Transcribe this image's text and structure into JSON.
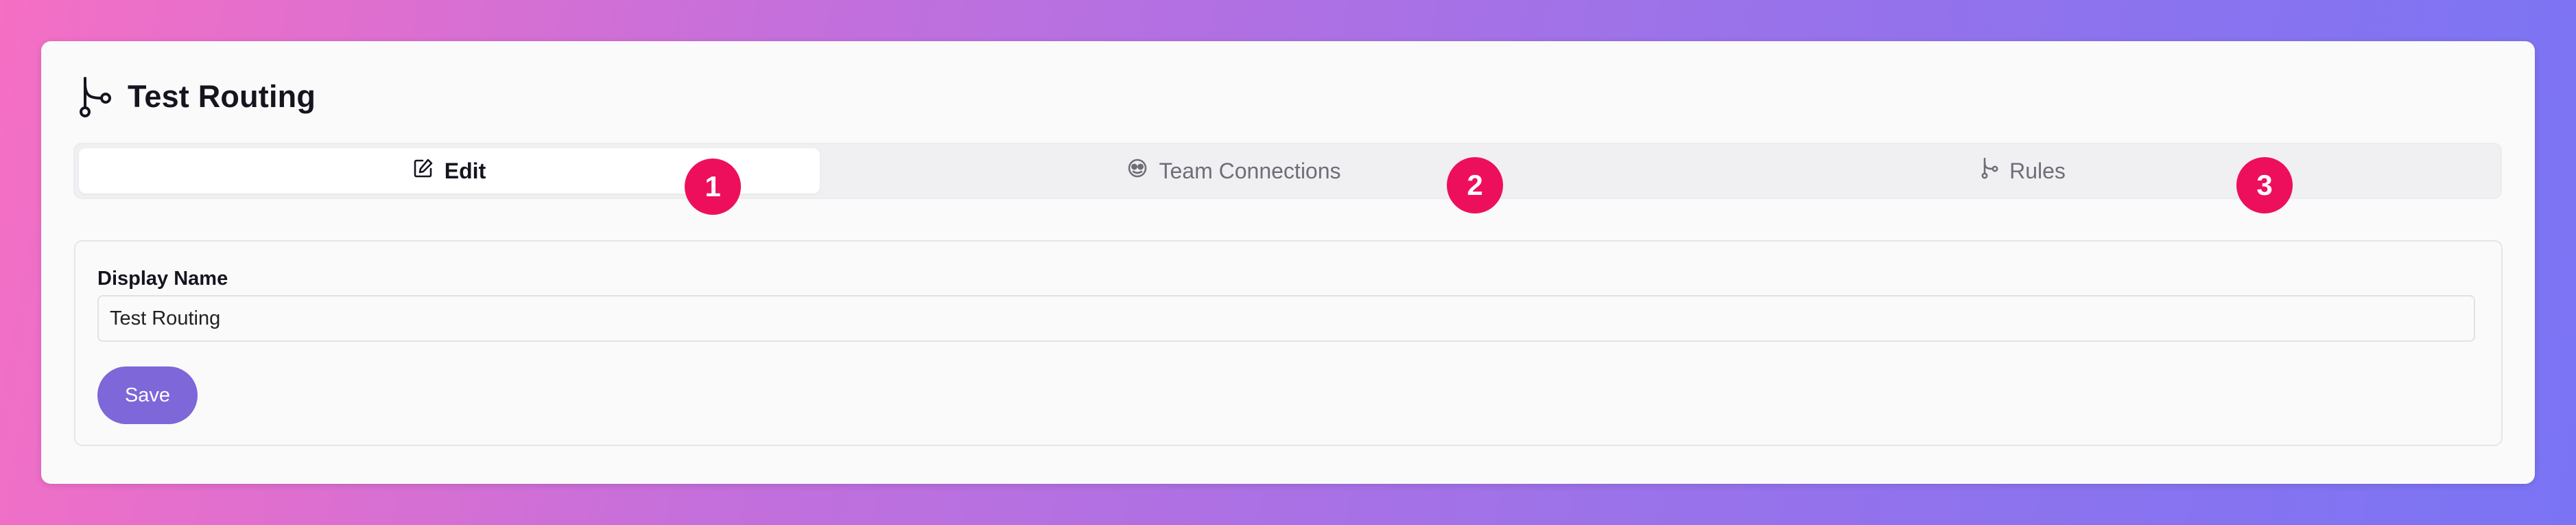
{
  "page": {
    "title": "Test Routing"
  },
  "tabs": [
    {
      "label": "Edit",
      "icon": "edit-icon",
      "active": true
    },
    {
      "label": "Team Connections",
      "icon": "team-connections-icon",
      "active": false
    },
    {
      "label": "Rules",
      "icon": "branch-icon",
      "active": false
    }
  ],
  "badges": [
    "1",
    "2",
    "3"
  ],
  "form": {
    "display_name_label": "Display Name",
    "display_name_value": "Test Routing",
    "save_label": "Save"
  },
  "colors": {
    "accent": "#7d67d9",
    "badge": "#ee0f5c",
    "title": "#15151f"
  }
}
